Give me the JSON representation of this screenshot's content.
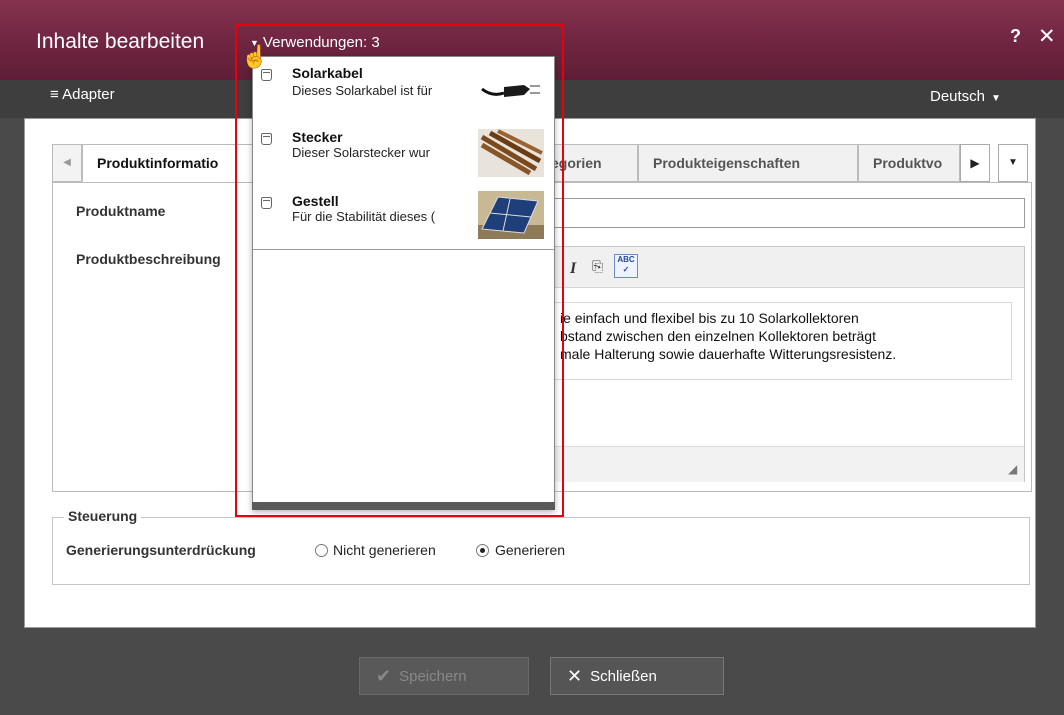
{
  "window": {
    "title": "Inhalte bearbeiten",
    "usage_label": "Verwendungen: 3",
    "help": "?",
    "close": "✕"
  },
  "subbar": {
    "adapter": "Adapter",
    "language": "Deutsch"
  },
  "tabs": [
    {
      "label": "Produktinformatio",
      "active": true
    },
    {
      "label": "egorien"
    },
    {
      "label": "Produkteigenschaften"
    },
    {
      "label": "Produktvo"
    }
  ],
  "form": {
    "product_name_label": "Produktname",
    "description_label": "Produktbeschreibung",
    "description_lines": [
      "ie einfach und flexibel bis zu 10 Solarkollektoren",
      "bstand zwischen den einzelnen Kollektoren beträgt",
      "male Halterung sowie dauerhafte Witterungsresistenz."
    ]
  },
  "control": {
    "legend": "Steuerung",
    "field_label": "Generierungsunterdrückung",
    "option_no": "Nicht generieren",
    "option_yes": "Generieren",
    "selected": "Generieren"
  },
  "buttons": {
    "save": "Speichern",
    "close": "Schließen"
  },
  "usages": [
    {
      "title": "Solarkabel",
      "description": "Dieses Solarkabel ist für",
      "thumb": "cable-plug"
    },
    {
      "title": "Stecker",
      "description": "Dieser Solarstecker wur",
      "thumb": "connectors"
    },
    {
      "title": "Gestell",
      "description": "Für die Stabilität dieses (",
      "thumb": "solar-rack"
    }
  ],
  "colors": {
    "titlebar": "#6f2540",
    "highlight": "#e8000d"
  }
}
